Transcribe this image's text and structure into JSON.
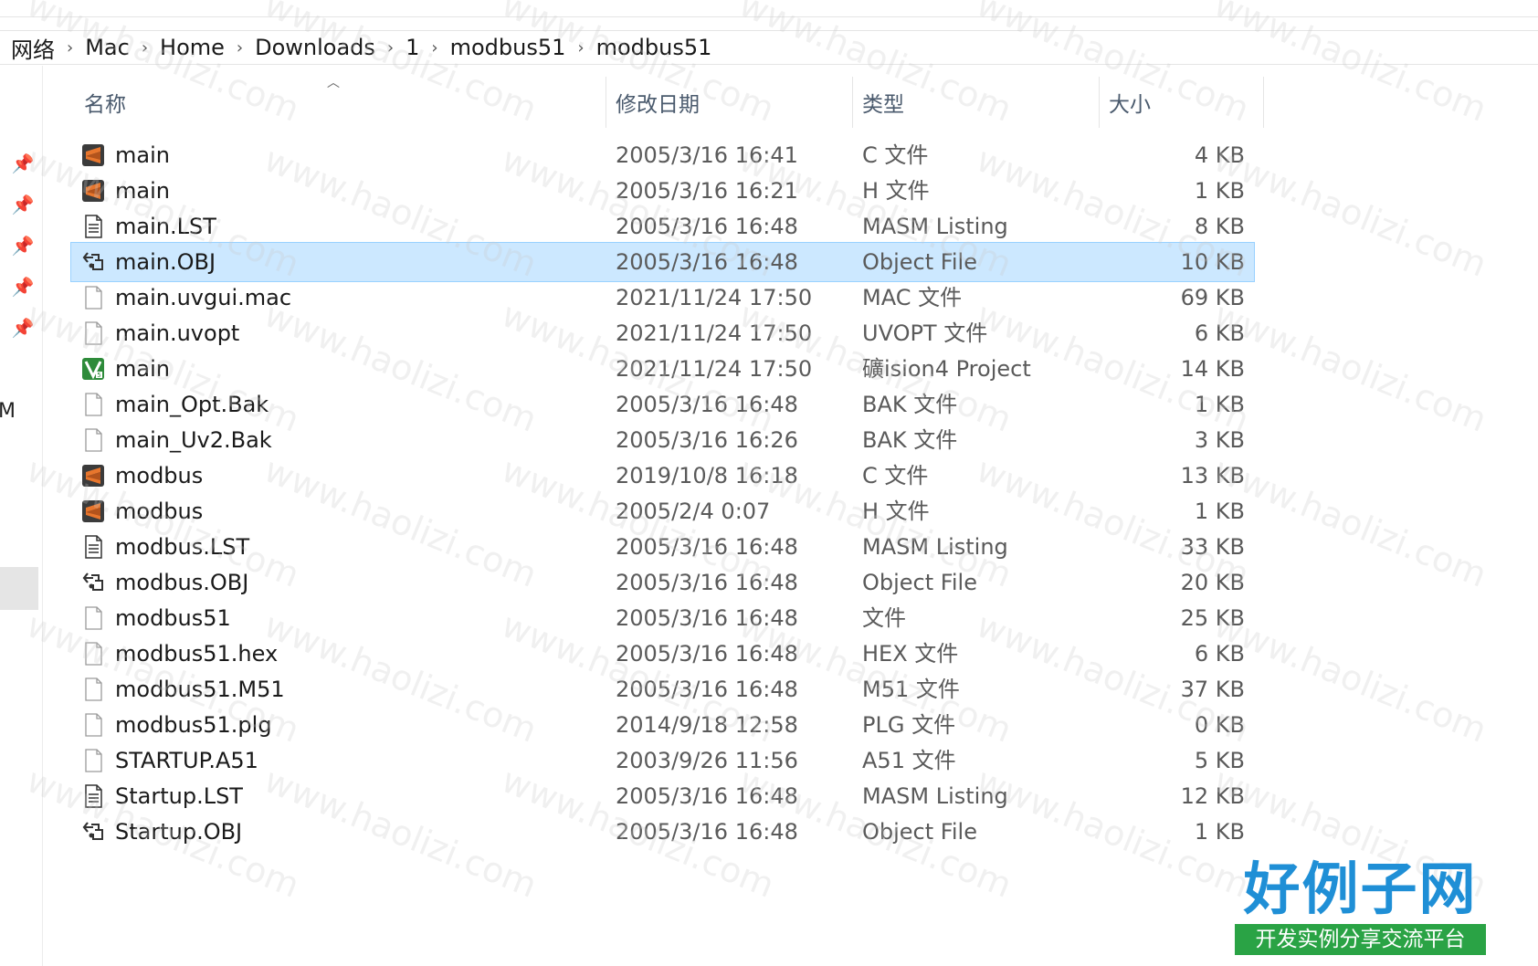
{
  "breadcrumb": [
    "网络",
    "Mac",
    "Home",
    "Downloads",
    "1",
    "modbus51",
    "modbus51"
  ],
  "nav_letter": "M",
  "columns": {
    "name": "名称",
    "modified": "修改日期",
    "type": "类型",
    "size": "大小"
  },
  "files": [
    {
      "icon": "sublime-icon",
      "name": "main",
      "modified": "2005/3/16 16:41",
      "type": "C 文件",
      "size": "4 KB"
    },
    {
      "icon": "sublime-icon",
      "name": "main",
      "modified": "2005/3/16 16:21",
      "type": "H 文件",
      "size": "1 KB"
    },
    {
      "icon": "text-document-icon",
      "name": "main.LST",
      "modified": "2005/3/16 16:48",
      "type": "MASM Listing",
      "size": "8 KB"
    },
    {
      "icon": "object-file-icon",
      "name": "main.OBJ",
      "modified": "2005/3/16 16:48",
      "type": "Object File",
      "size": "10 KB",
      "selected": true
    },
    {
      "icon": "blank-file-icon",
      "name": "main.uvgui.mac",
      "modified": "2021/11/24 17:50",
      "type": "MAC 文件",
      "size": "69 KB"
    },
    {
      "icon": "blank-file-icon",
      "name": "main.uvopt",
      "modified": "2021/11/24 17:50",
      "type": "UVOPT 文件",
      "size": "6 KB"
    },
    {
      "icon": "keil-project-icon",
      "name": "main",
      "modified": "2021/11/24 17:50",
      "type": "礦ision4 Project",
      "size": "14 KB"
    },
    {
      "icon": "blank-file-icon",
      "name": "main_Opt.Bak",
      "modified": "2005/3/16 16:48",
      "type": "BAK 文件",
      "size": "1 KB"
    },
    {
      "icon": "blank-file-icon",
      "name": "main_Uv2.Bak",
      "modified": "2005/3/16 16:26",
      "type": "BAK 文件",
      "size": "3 KB"
    },
    {
      "icon": "sublime-icon",
      "name": "modbus",
      "modified": "2019/10/8 16:18",
      "type": "C 文件",
      "size": "13 KB"
    },
    {
      "icon": "sublime-icon",
      "name": "modbus",
      "modified": "2005/2/4 0:07",
      "type": "H 文件",
      "size": "1 KB"
    },
    {
      "icon": "text-document-icon",
      "name": "modbus.LST",
      "modified": "2005/3/16 16:48",
      "type": "MASM Listing",
      "size": "33 KB"
    },
    {
      "icon": "object-file-icon",
      "name": "modbus.OBJ",
      "modified": "2005/3/16 16:48",
      "type": "Object File",
      "size": "20 KB"
    },
    {
      "icon": "blank-file-icon",
      "name": "modbus51",
      "modified": "2005/3/16 16:48",
      "type": "文件",
      "size": "25 KB"
    },
    {
      "icon": "blank-file-icon",
      "name": "modbus51.hex",
      "modified": "2005/3/16 16:48",
      "type": "HEX 文件",
      "size": "6 KB"
    },
    {
      "icon": "blank-file-icon",
      "name": "modbus51.M51",
      "modified": "2005/3/16 16:48",
      "type": "M51 文件",
      "size": "37 KB"
    },
    {
      "icon": "blank-file-icon",
      "name": "modbus51.plg",
      "modified": "2014/9/18 12:58",
      "type": "PLG 文件",
      "size": "0 KB"
    },
    {
      "icon": "blank-file-icon",
      "name": "STARTUP.A51",
      "modified": "2003/9/26 11:56",
      "type": "A51 文件",
      "size": "5 KB"
    },
    {
      "icon": "text-document-icon",
      "name": "Startup.LST",
      "modified": "2005/3/16 16:48",
      "type": "MASM Listing",
      "size": "12 KB"
    },
    {
      "icon": "object-file-icon",
      "name": "Startup.OBJ",
      "modified": "2005/3/16 16:48",
      "type": "Object File",
      "size": "1 KB"
    }
  ],
  "watermark": "www.haolizi.com",
  "logo": {
    "title": "好例子网",
    "subtitle": "开发实例分享交流平台"
  },
  "colors": {
    "selection": "#cce8ff",
    "selection_border": "#99d1ff",
    "sublime": "#e8762d",
    "keil": "#2e8b3a",
    "logo_blue": "#1f8fd6",
    "logo_green": "#2aa345"
  }
}
